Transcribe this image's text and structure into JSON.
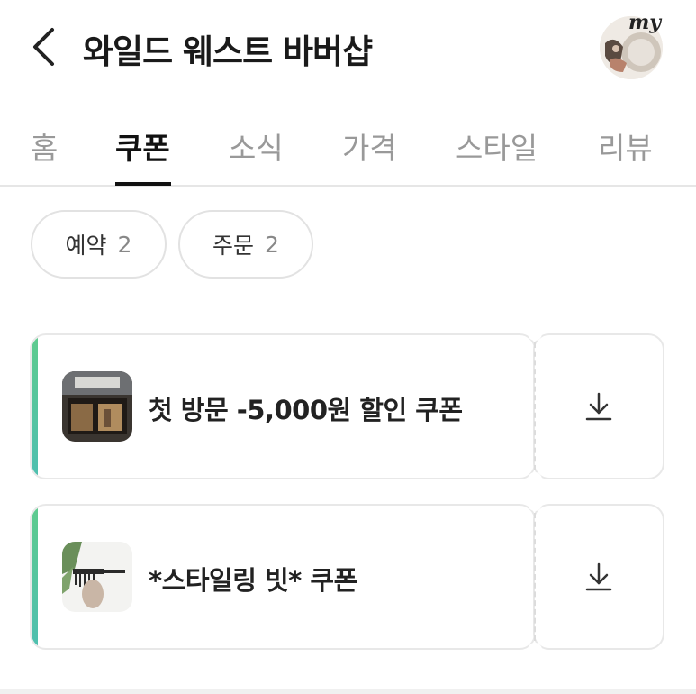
{
  "header": {
    "title": "와일드 웨스트 바버샵",
    "avatar_label": "my",
    "back_icon": "chevron-left-icon"
  },
  "tabs": [
    {
      "label": "홈",
      "active": false
    },
    {
      "label": "쿠폰",
      "active": true
    },
    {
      "label": "소식",
      "active": false
    },
    {
      "label": "가격",
      "active": false
    },
    {
      "label": "스타일",
      "active": false
    },
    {
      "label": "리뷰",
      "active": false
    }
  ],
  "filters": [
    {
      "label": "예약",
      "count": "2"
    },
    {
      "label": "주문",
      "count": "2"
    }
  ],
  "coupons": [
    {
      "title": "첫 방문 -5,000원 할인 쿠폰",
      "icon": "download-icon"
    },
    {
      "title": "*스타일링 빗* 쿠폰",
      "icon": "download-icon"
    }
  ],
  "colors": {
    "accent_start": "#5fcb8e",
    "accent_end": "#4fbfb0",
    "active_tab": "#111111",
    "inactive_tab": "#999999"
  }
}
